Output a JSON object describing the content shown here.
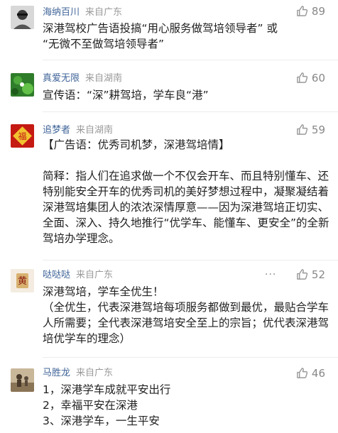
{
  "comments": [
    {
      "username": "海纳百川",
      "location": "来自广东",
      "likes": "89",
      "text": "深港驾校广告语投搞“用心服务做驾培领导者” 或\n“无微不至做驾培领导者”"
    },
    {
      "username": "真爱无限",
      "location": "来自湖南",
      "likes": "60",
      "text": "宣传语：“深”耕驾培，学车良“港”"
    },
    {
      "username": "追梦者",
      "location": "来自湖南",
      "likes": "59",
      "text": "【广告语：优秀司机梦，深港驾培情】\n\n简释：指人们在追求做一个不仅会开车、而且特别懂车、还特别能安全开车的优秀司机的美好梦想过程中，凝聚凝结着深港驾培集团人的浓浓深情厚意——因为深港驾培正切实、全面、深入、持久地推行“优学车、能懂车、更安全”的全新驾培办学理念。"
    },
    {
      "username": "哒哒哒",
      "location": "来自广东",
      "likes": "52",
      "more": "···",
      "text": "深港驾培，学车全优生！\n（全优生，代表深港驾培每项服务都做到最优，最贴合学车人所需要；全代表深港驾培安全至上的宗旨；优代表深港驾培优学车的理念）"
    },
    {
      "username": "马胜龙",
      "location": "来自广东",
      "likes": "46",
      "text": "1，深港学车成就平安出行\n2，幸福平安在深港\n3、深港学车，一生平安"
    }
  ]
}
